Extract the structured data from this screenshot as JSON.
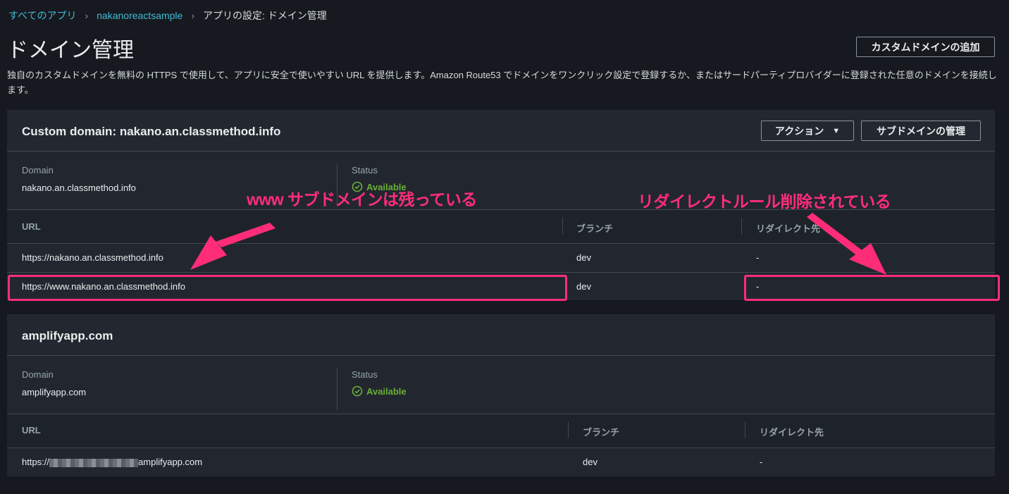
{
  "breadcrumb": {
    "all_apps": "すべてのアプリ",
    "app": "nakanoreactsample",
    "current": "アプリの設定: ドメイン管理"
  },
  "page": {
    "title": "ドメイン管理",
    "add_domain_button": "カスタムドメインの追加",
    "description": "独自のカスタムドメインを無料の HTTPS で使用して、アプリに安全で使いやすい URL を提供します。Amazon Route53 でドメインをワンクリック設定で登録するか、またはサードパーティプロバイダーに登録された任意のドメインを接続します。"
  },
  "custom_domain": {
    "title": "Custom domain: nakano.an.classmethod.info",
    "actions_button": "アクション",
    "manage_subdomains_button": "サブドメインの管理",
    "domain_label": "Domain",
    "domain_value": "nakano.an.classmethod.info",
    "status_label": "Status",
    "status_value": "Available",
    "columns": {
      "url": "URL",
      "branch": "ブランチ",
      "redirect": "リダイレクト先"
    },
    "rows": [
      {
        "url": "https://nakano.an.classmethod.info",
        "branch": "dev",
        "redirect": "-"
      },
      {
        "url": "https://www.nakano.an.classmethod.info",
        "branch": "dev",
        "redirect": "-"
      }
    ]
  },
  "amplify_domain": {
    "title": "amplifyapp.com",
    "domain_label": "Domain",
    "domain_value": "amplifyapp.com",
    "status_label": "Status",
    "status_value": "Available",
    "columns": {
      "url": "URL",
      "branch": "ブランチ",
      "redirect": "リダイレクト先"
    },
    "rows": [
      {
        "url_prefix": "https://",
        "url_suffix": "amplifyapp.com",
        "branch": "dev",
        "redirect": "-"
      }
    ]
  },
  "annotations": {
    "left": "www サブドメインは残っている",
    "right": "リダイレクトルール削除されている",
    "color": "#ff2d78"
  }
}
